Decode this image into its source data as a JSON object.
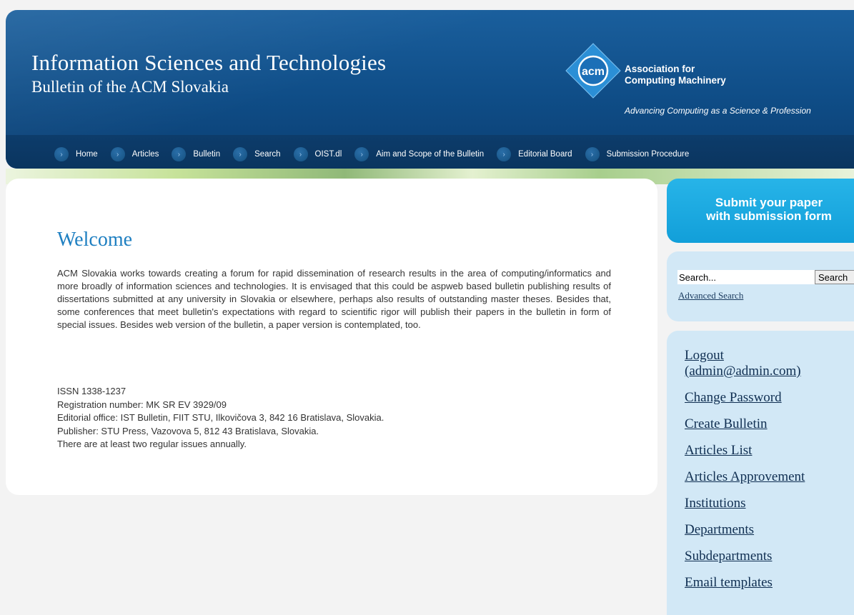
{
  "header": {
    "title": "Information Sciences and Technologies",
    "subtitle": "Bulletin of the ACM Slovakia",
    "acm_logo_text": "acm",
    "acm_name_line1": "Association for",
    "acm_name_line2": "Computing Machinery",
    "acm_tagline": "Advancing Computing as a Science & Profession"
  },
  "nav": {
    "items": [
      {
        "label": "Home"
      },
      {
        "label": "Articles"
      },
      {
        "label": "Bulletin"
      },
      {
        "label": "Search"
      },
      {
        "label": "OIST.dl"
      },
      {
        "label": "Aim and Scope of the Bulletin"
      },
      {
        "label": "Editorial Board"
      },
      {
        "label": "Submission Procedure"
      }
    ]
  },
  "main": {
    "title": "Welcome",
    "intro": "ACM Slovakia works towards creating a forum for rapid dissemination of research results in the area of computing/informatics and more broadly of information sciences and technologies. It is envisaged that this could be aspweb based bulletin publishing results of dissertations submitted at any university in Slovakia or elsewhere, perhaps also results of outstanding master theses. Besides that, some conferences that meet bulletin's expectations with regard to scientific rigor will publish their papers in the bulletin in form of special issues. Besides web version of the bulletin, a paper version is contemplated, too.",
    "info": [
      "ISSN 1338-1237",
      "Registration number: MK SR EV 3929/09",
      "Editorial office: IST Bulletin, FIIT STU, Ilkovičova 3, 842 16 Bratislava, Slovakia.",
      "Publisher: STU Press, Vazovova 5, 812 43 Bratislava, Slovakia.",
      "There are at least two regular issues annually."
    ]
  },
  "sidebar": {
    "submit_line1": "Submit your paper",
    "submit_line2": "with submission form",
    "search": {
      "value": "Search...",
      "button": "Search",
      "advanced": "Advanced Search"
    },
    "admin_links": [
      {
        "label": "Logout"
      },
      {
        "label": "(admin@admin.com)"
      },
      {
        "label": "Change Password"
      },
      {
        "label": "Create Bulletin"
      },
      {
        "label": "Articles List"
      },
      {
        "label": "Articles Approvement"
      },
      {
        "label": "Institutions"
      },
      {
        "label": "Departments"
      },
      {
        "label": "Subdepartments"
      },
      {
        "label": "Email templates"
      }
    ]
  },
  "colors": {
    "header_blue": "#0f4d87",
    "nav_blue": "#0a355f",
    "welcome_blue": "#1e7fc1",
    "submit_blue": "#129fd9",
    "sidebar_light": "#d2e8f6"
  },
  "icons": {
    "nav_bullet": "chevron-right-icon",
    "logo": "acm-diamond-logo"
  }
}
